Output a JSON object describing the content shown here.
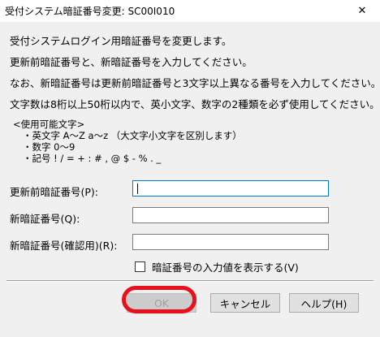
{
  "window": {
    "title": "受付システム暗証番号変更: SC00I010",
    "close_glyph": "✕"
  },
  "instructions": [
    "受付システムログイン用暗証番号を変更します。",
    "更新前暗証番号と、新暗証番号を入力してください。",
    "なお、新暗証番号は更新前暗証番号と3文字以上異なる番号を入力してください。",
    "文字数は8桁以上50桁以内で、英小文字、数字の2種類を必ず使用してください。"
  ],
  "allowed_chars": {
    "heading": "<使用可能文字>",
    "items": [
      "・英文字  A〜Z  a〜z （大文字小文字を区別します）",
      "・数字  0〜9",
      "・記号  ! / = + : # , @ $ - % . _"
    ]
  },
  "form": {
    "current_label": "更新前暗証番号(P):",
    "current_value": "",
    "new_label": "新暗証番号(Q):",
    "new_value": "",
    "confirm_label": "新暗証番号(確認用)(R):",
    "confirm_value": ""
  },
  "show_input": {
    "label": "暗証番号の入力値を表示する(V)",
    "checked": false
  },
  "buttons": {
    "ok": "OK",
    "cancel": "キャンセル",
    "help": "ヘルプ(H)"
  },
  "colors": {
    "highlight": "#e8101a",
    "focus_border": "#0078d7"
  }
}
